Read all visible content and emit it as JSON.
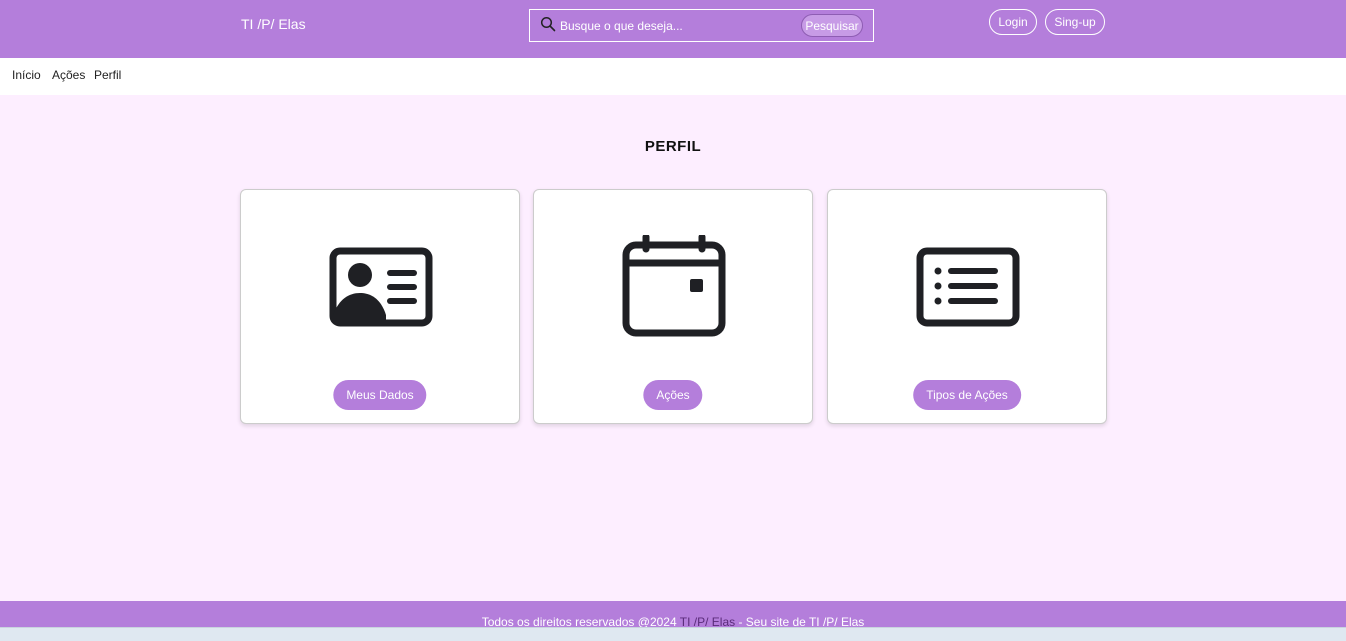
{
  "header": {
    "brand": "TI /P/ Elas",
    "search": {
      "placeholder": "Busque o que deseja...",
      "button_label": "Pesquisar"
    },
    "login_label": "Login",
    "signup_label": "Sing-up"
  },
  "nav": {
    "items": [
      {
        "label": "Início"
      },
      {
        "label": "Ações"
      },
      {
        "label": "Perfil"
      }
    ]
  },
  "main": {
    "title": "PERFIL",
    "cards": [
      {
        "icon": "id-card-icon",
        "button_label": "Meus Dados"
      },
      {
        "icon": "calendar-icon",
        "button_label": "Ações"
      },
      {
        "icon": "list-icon",
        "button_label": "Tipos de Ações"
      }
    ]
  },
  "footer": {
    "text_prefix": "Todos os direitos reservados @2024",
    "brand": "TI /P/ Elas",
    "text_suffix": "- Seu site de TI /P/ Elas"
  },
  "colors": {
    "accent": "#b47edb",
    "page_background": "#fdeeff",
    "icon": "#1f2024"
  }
}
